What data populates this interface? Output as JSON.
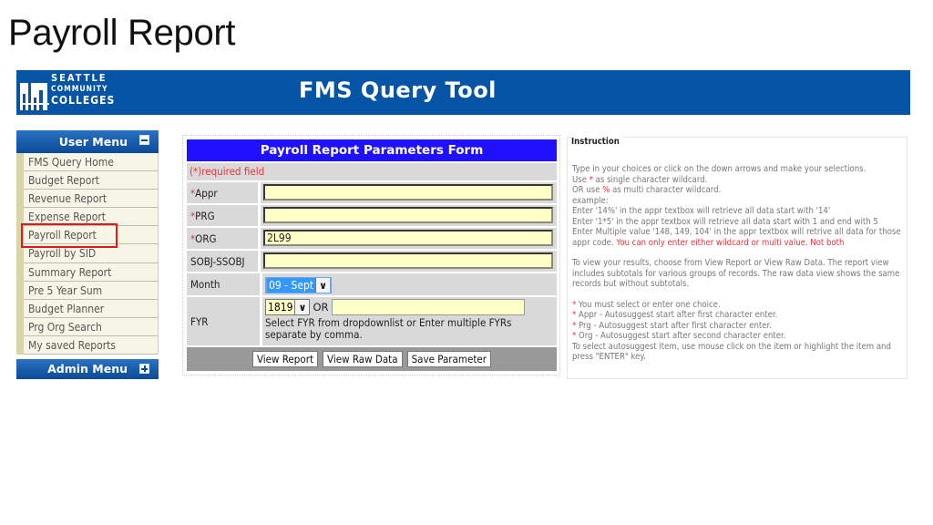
{
  "slide": {
    "title": "Payroll Report"
  },
  "banner": {
    "logo": {
      "line1": "SEATTLE",
      "line2": "COMMUNITY",
      "line3": "COLLEGES"
    },
    "title": "FMS Query Tool",
    "color": "#0554a5"
  },
  "sidebar": {
    "user_menu_label": "User Menu",
    "admin_menu_label": "Admin Menu",
    "items": [
      {
        "label": "FMS Query Home"
      },
      {
        "label": "Budget Report"
      },
      {
        "label": "Revenue Report"
      },
      {
        "label": "Expense Report"
      },
      {
        "label": "Payroll Report",
        "highlighted": true
      },
      {
        "label": "Payroll by SID"
      },
      {
        "label": "Summary Report"
      },
      {
        "label": "Pre 5 Year Sum"
      },
      {
        "label": "Budget Planner"
      },
      {
        "label": "Prg Org Search"
      },
      {
        "label": "My saved Reports"
      }
    ]
  },
  "form": {
    "title": "Payroll Report Parameters Form",
    "required_note": "(*)required field",
    "required_star": "*",
    "fields": {
      "appr": {
        "label": "Appr",
        "value": ""
      },
      "prg": {
        "label": "PRG",
        "value": ""
      },
      "org": {
        "label": "ORG",
        "value": "2L99"
      },
      "sobj": {
        "label": "SOBJ-SSOBJ",
        "value": ""
      },
      "month": {
        "label": "Month",
        "selected": "09 - Sept"
      },
      "fyr": {
        "label": "FYR",
        "selected": "1819",
        "or_label": "OR",
        "input_value": "",
        "help": "Select FYR from dropdownlist or Enter multiple FYRs separate by comma."
      }
    },
    "buttons": {
      "view_report": "View Report",
      "view_raw": "View Raw Data",
      "save_param": "Save Parameter"
    },
    "header_color": "#1f10ff"
  },
  "instruction": {
    "title": "Instruction",
    "p1_line1": "Type in your choices or click on the down arrows and make your selections.",
    "p1_line2a": "Use ",
    "p1_line2_sym": "*",
    "p1_line2b": " as single character wildcard.",
    "p1_line3a": "OR use ",
    "p1_line3_sym": "%",
    "p1_line3b": " as multi character wildcard.",
    "p1_line4": "example:",
    "p1_line5": "Enter '14%' in the appr textbox will retrieve all data start with '14'",
    "p1_line6": "Enter '1*5' in the appr textbox will retrieve all data start with 1 and end with 5",
    "p1_line7": "Enter Multiple value '148, 149, 104' in the appr textbox will retrive all data for those appr code. ",
    "p1_warning": "You can only enter either wildcard or multi value. Not both",
    "p2": "To view your results, choose from View Report or View Raw Data. The report view includes subtotals for various groups of records. The raw data view shows the same records but without subtotals.",
    "star": "*",
    "notes": [
      " You must select or enter one choice.",
      " Appr - Autosuggest start after first character enter.",
      " Prg - Autosuggest start after first character enter.",
      " Org - Autosuggest start after second character enter."
    ],
    "final": "To select autosuggest item, use mouse click on the item or highlight the item and press \"ENTER\" key."
  }
}
